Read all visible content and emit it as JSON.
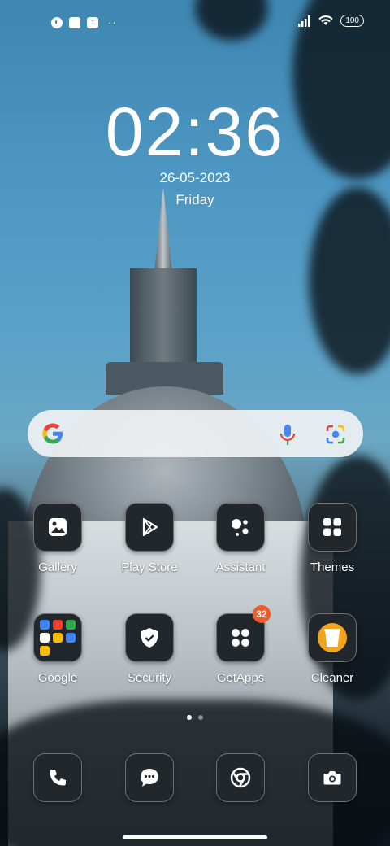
{
  "status_bar": {
    "notification_icons": [
      "nfc-icon",
      "square-icon",
      "upload-icon"
    ],
    "overflow": "··",
    "battery": "100"
  },
  "clock": {
    "time": "02:36",
    "date": "26-05-2023",
    "day": "Friday"
  },
  "search_bar": {
    "logo": "google-g-icon",
    "mic": "microphone-icon",
    "lens": "lens-icon"
  },
  "apps_row1": [
    {
      "label": "Gallery",
      "icon": "gallery-icon"
    },
    {
      "label": "Play Store",
      "icon": "play-store-icon"
    },
    {
      "label": "Assistant",
      "icon": "assistant-icon"
    },
    {
      "label": "Themes",
      "icon": "themes-icon"
    }
  ],
  "apps_row2": [
    {
      "label": "Google",
      "icon": "google-folder-icon"
    },
    {
      "label": "Security",
      "icon": "security-shield-icon"
    },
    {
      "label": "GetApps",
      "icon": "getapps-icon",
      "badge": "32"
    },
    {
      "label": "Cleaner",
      "icon": "cleaner-icon"
    }
  ],
  "dock": [
    {
      "icon": "phone-icon"
    },
    {
      "icon": "messages-icon"
    },
    {
      "icon": "chrome-icon"
    },
    {
      "icon": "camera-icon"
    }
  ],
  "page_indicator": {
    "pages": 2,
    "active": 0
  },
  "colors": {
    "badge": "#ef5a28",
    "icon_bg": "#22272b"
  }
}
